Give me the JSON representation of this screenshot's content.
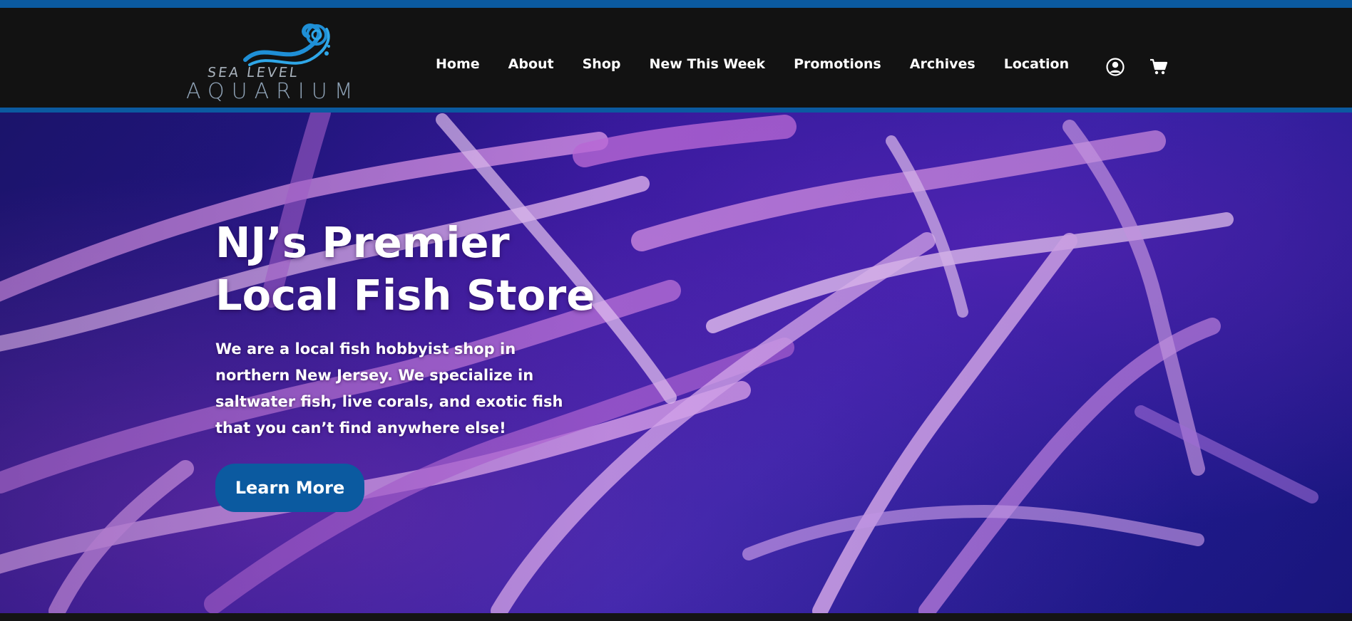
{
  "header": {
    "logo": {
      "line1": "SEA LEVEL",
      "line2": "AQUARIUM"
    },
    "nav": [
      {
        "label": "Home"
      },
      {
        "label": "About"
      },
      {
        "label": "Shop"
      },
      {
        "label": "New This Week"
      },
      {
        "label": "Promotions"
      },
      {
        "label": "Archives"
      },
      {
        "label": "Location"
      }
    ],
    "icons": {
      "account": "user-circle-icon",
      "cart": "shopping-cart-icon"
    }
  },
  "hero": {
    "title_line1": "NJ’s Premier",
    "title_line2": "Local Fish Store",
    "description": "We are a local fish hobbyist shop in northern New Jersey. We specialize in saltwater fish, live corals, and exotic fish that you can’t find anywhere else!",
    "button_label": "Learn More"
  },
  "colors": {
    "brand_blue": "#0b5aa0",
    "header_bg": "#121212",
    "anemone_pink": "#d890f0",
    "water_blue": "#2a1796"
  }
}
